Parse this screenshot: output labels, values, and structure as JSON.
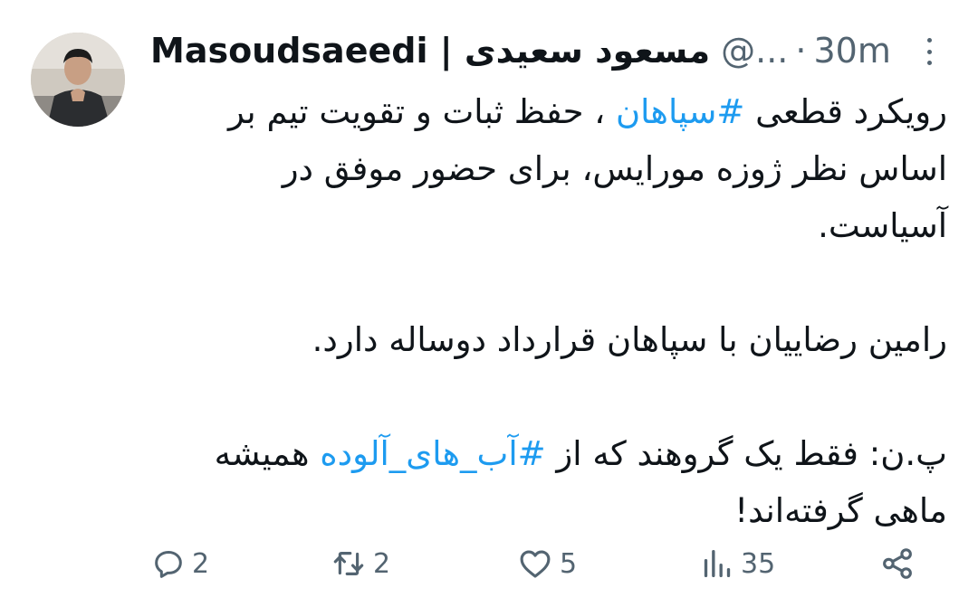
{
  "author": {
    "display_name": "Masoudsaeedi | مسعود سعیدی",
    "handle": "@...",
    "separator": "·",
    "time": "30m"
  },
  "tweet": {
    "paragraph_1": {
      "before": "رویکرد قطعی ",
      "hashtag": "#سپاهان",
      "after": " ، حفظ ثبات و تقویت تیم بر اساس نظر ژوزه مورایس، برای حضور موفق در آسیاست."
    },
    "paragraph_2": "رامین رضاییان با سپاهان قرارداد دوساله دارد.",
    "paragraph_3": {
      "before": "پ.ن: فقط یک گروهند که از ",
      "hashtag": "#آب_های_آلوده",
      "after": " همیشه ماهی گرفته‌اند!"
    }
  },
  "actions": {
    "reply_count": "2",
    "retweet_count": "2",
    "like_count": "5",
    "views_count": "35"
  },
  "icons": {
    "reply": "reply-icon",
    "retweet": "retweet-icon",
    "like": "heart-icon",
    "views": "views-icon",
    "share": "share-icon",
    "more": "more-icon"
  },
  "colors": {
    "text": "#0f1419",
    "secondary": "#536471",
    "link": "#1d9bf0"
  }
}
